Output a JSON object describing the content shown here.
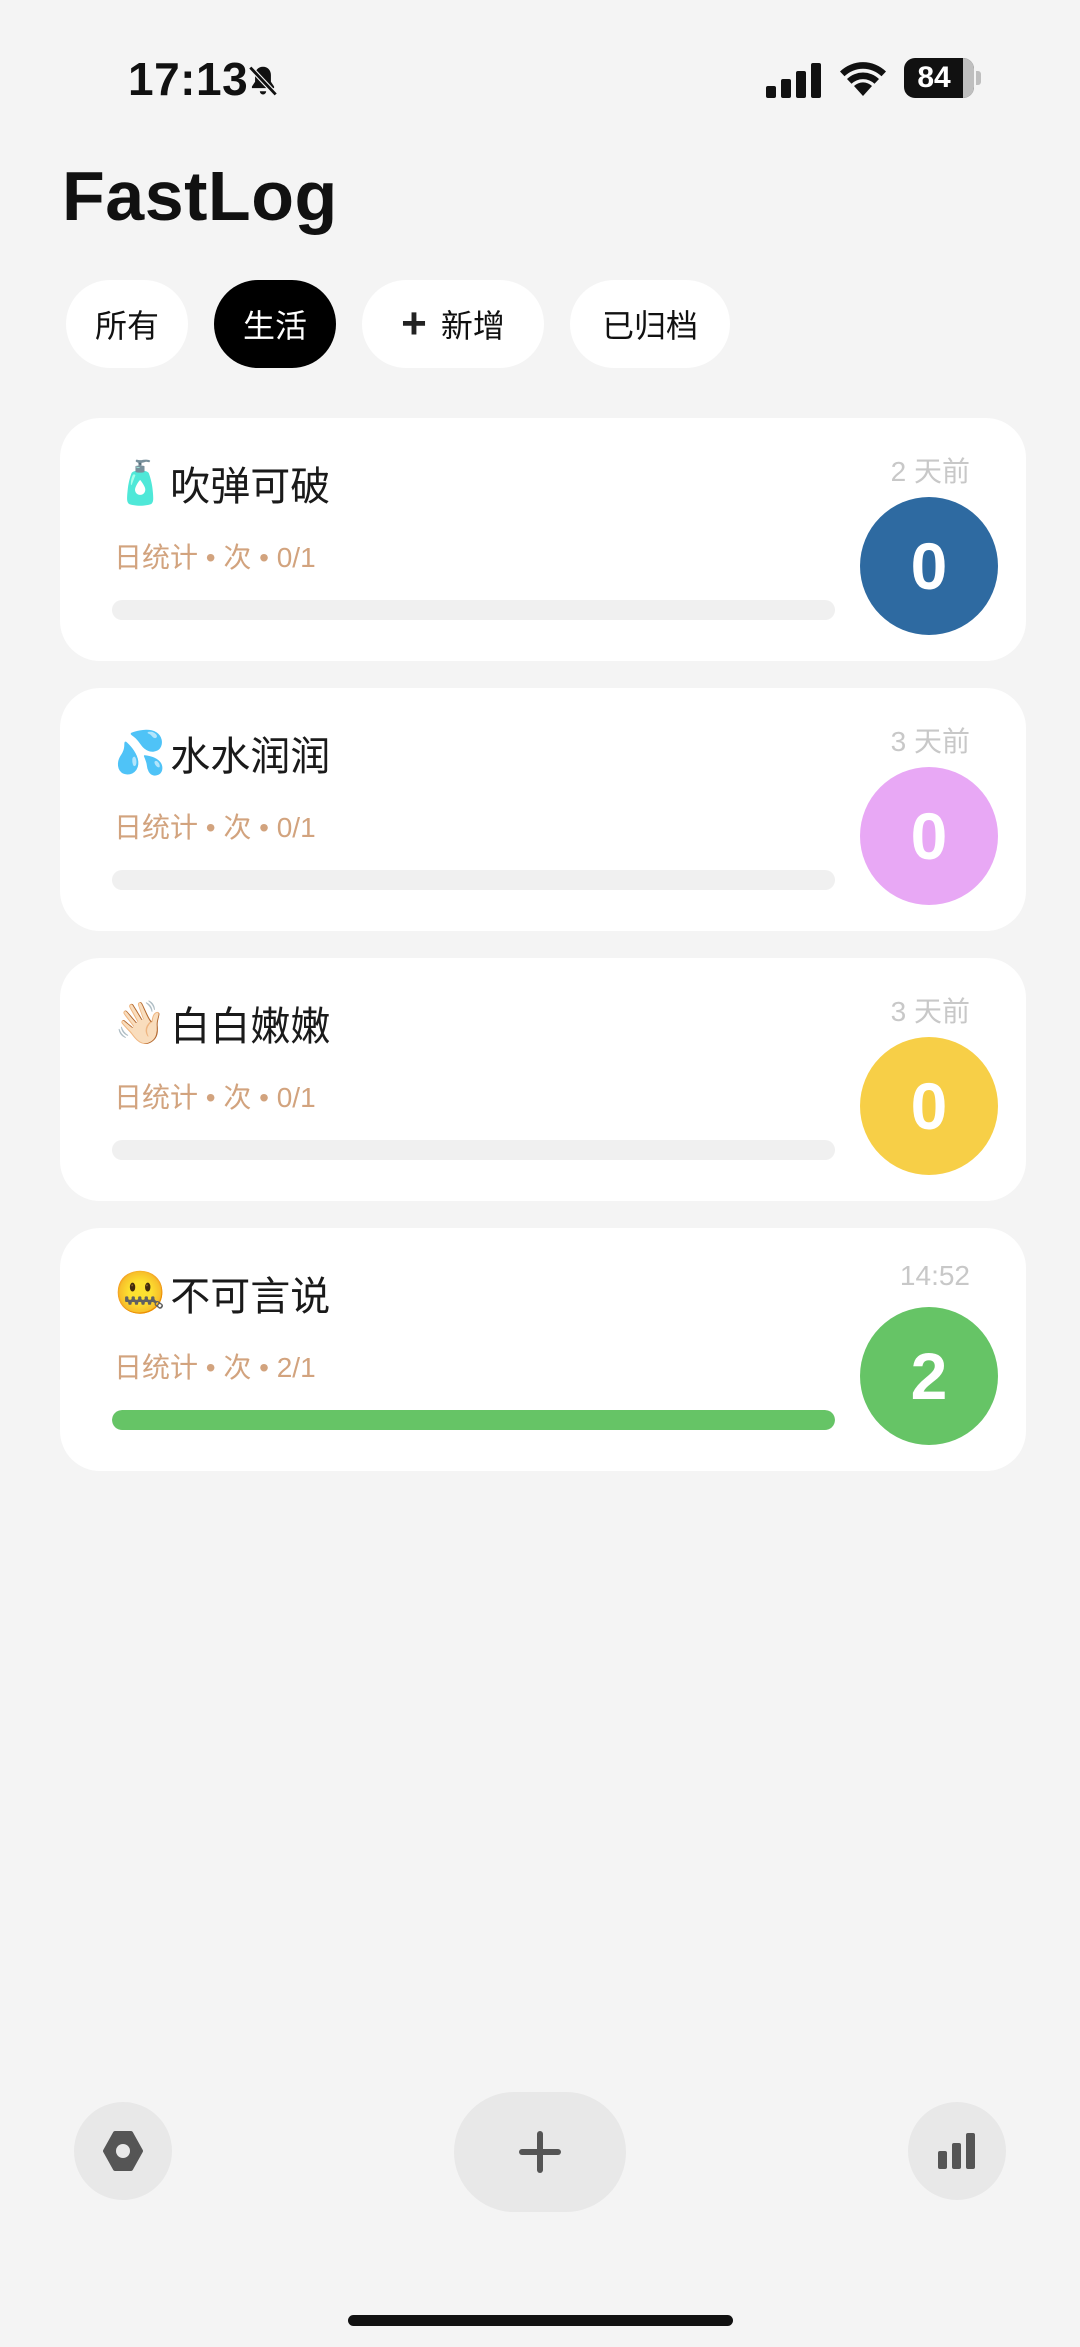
{
  "status_bar": {
    "time": "17:13",
    "battery": "84"
  },
  "app": {
    "title": "FastLog"
  },
  "tabs": [
    {
      "label": "所有",
      "active": false
    },
    {
      "label": "生活",
      "active": true
    },
    {
      "label": "新增",
      "active": false,
      "icon": "plus-icon"
    },
    {
      "label": "已归档",
      "active": false
    }
  ],
  "cards": [
    {
      "emoji": "🧴",
      "name": "吹弹可破",
      "meta": "日统计 • 次 • 0/1",
      "time": "2 天前",
      "count": "0",
      "color": "#2e6aa1",
      "progress": 0
    },
    {
      "emoji": "💦",
      "name": "水水润润",
      "meta": "日统计 • 次 • 0/1",
      "time": "3 天前",
      "count": "0",
      "color": "#e8a8f5",
      "progress": 0
    },
    {
      "emoji": "👋🏻",
      "name": "白白嫩嫩",
      "meta": "日统计 • 次 • 0/1",
      "time": "3 天前",
      "count": "0",
      "color": "#f7cf47",
      "progress": 0
    },
    {
      "emoji": "🤐",
      "name": "不可言说",
      "meta": "日统计 • 次 • 2/1",
      "time": "14:52",
      "count": "2",
      "color": "#66c466",
      "progress": 1
    }
  ],
  "bottom_bar": {
    "settings_icon": "settings-hexagon-icon",
    "add_icon": "plus-icon",
    "stats_icon": "bar-chart-icon"
  }
}
